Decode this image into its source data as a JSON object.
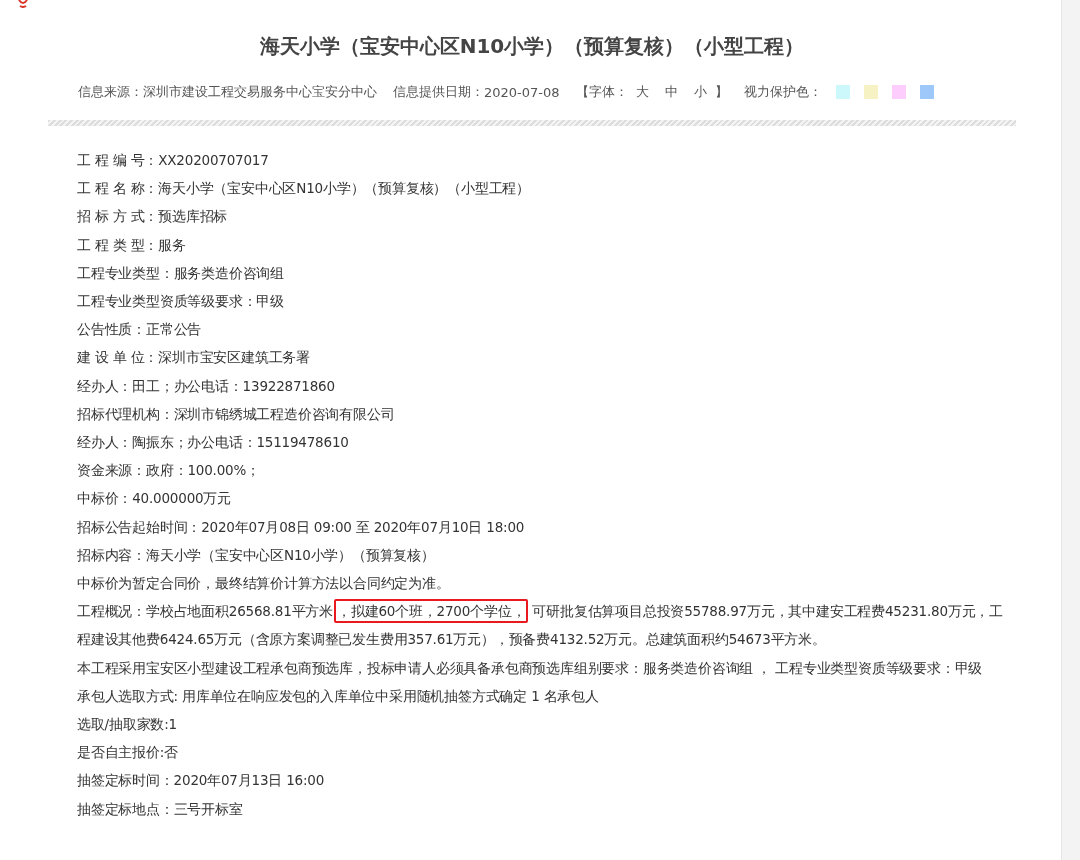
{
  "title": "海天小学（宝安中心区N10小学）（预算复核）（小型工程）",
  "meta": {
    "source_label": "信息来源：",
    "source": "深圳市建设工程交易服务中心宝安分中心",
    "date_label": "信息提供日期：",
    "date": "2020-07-08",
    "font_open": "【字体：",
    "font_sizes": [
      "大",
      "中",
      "小"
    ],
    "font_close": "】",
    "eye_label": "视力保护色：",
    "swatches": [
      {
        "color": "#ccf7fb"
      },
      {
        "color": "#f7f2c4"
      },
      {
        "color": "#fdcdfd"
      },
      {
        "color": "#9fc8fa"
      }
    ]
  },
  "rows": [
    {
      "kind": "text",
      "text": "工 程 编 号：XX20200707017"
    },
    {
      "kind": "text",
      "text": "工 程 名 称：海天小学（宝安中心区N10小学）（预算复核）（小型工程）"
    },
    {
      "kind": "text",
      "text": "招 标 方 式：预选库招标"
    },
    {
      "kind": "text",
      "text": "工 程 类 型：服务"
    },
    {
      "kind": "text",
      "text": "工程专业类型：服务类造价咨询组"
    },
    {
      "kind": "text",
      "text": "工程专业类型资质等级要求：甲级"
    },
    {
      "kind": "text",
      "text": "公告性质：正常公告"
    },
    {
      "kind": "text",
      "text": "建 设 单 位：深圳市宝安区建筑工务署"
    },
    {
      "kind": "text",
      "text": "经办人：田工；办公电话：13922871860"
    },
    {
      "kind": "text",
      "text": "招标代理机构：深圳市锦绣城工程造价咨询有限公司"
    },
    {
      "kind": "text",
      "text": "经办人：陶振东；办公电话：15119478610"
    },
    {
      "kind": "text",
      "text": "资金来源：政府：100.00%；"
    },
    {
      "kind": "text",
      "text": "中标价：40.000000万元"
    },
    {
      "kind": "text",
      "text": "招标公告起始时间：2020年07月08日 09:00 至 2020年07月10日 18:00"
    },
    {
      "kind": "text",
      "text": "招标内容：海天小学（宝安中心区N10小学）（预算复核）"
    },
    {
      "kind": "text",
      "text": "中标价为暂定合同价，最终结算价计算方法以合同约定为准。"
    },
    {
      "kind": "segmented",
      "segments": [
        {
          "text": "工程概况：学校占地面积26568.81平方米",
          "highlighted": false
        },
        {
          "text": "，拟建60个班，2700个学位，",
          "highlighted": true
        },
        {
          "text": "可研批复估算项目总投资55788.97万元，其中建安工程费45231.80万元，工程建设其他费6424.65万元（含原方案调整已发生费用357.61万元），预备费4132.52万元。总建筑面积约54673平方米。",
          "highlighted": false
        }
      ]
    },
    {
      "kind": "text",
      "text": "本工程采用宝安区小型建设工程承包商预选库，投标申请人必须具备承包商预选库组别要求：服务类造价咨询组 ， 工程专业类型资质等级要求：甲级"
    },
    {
      "kind": "text",
      "text": "承包人选取方式: 用库单位在响应发包的入库单位中采用随机抽签方式确定 1 名承包人"
    },
    {
      "kind": "text",
      "text": "选取/抽取家数:1"
    },
    {
      "kind": "text",
      "text": "是否自主报价:否"
    },
    {
      "kind": "text",
      "text": "抽签定标时间：2020年07月13日 16:00"
    },
    {
      "kind": "text",
      "text": "抽签定标地点：三号开标室"
    }
  ]
}
